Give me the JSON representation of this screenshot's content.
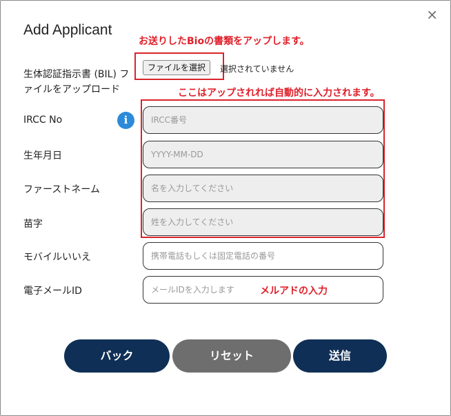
{
  "modal": {
    "title": "Add Applicant",
    "close_symbol": "×"
  },
  "annotations": {
    "bio_upload_note": "お送りしたBioの書類をアップします。",
    "auto_fill_note": "ここはアップされれば自動的に入力されます。",
    "email_note": "メルアドの入力"
  },
  "form": {
    "bil_label_line1": "生体認証指示書 (BIL) フ",
    "bil_label_line2": "ァイルをアップロード",
    "file_button_label": "ファイルを選択",
    "file_status": "選択されていません",
    "ircc_label": "IRCC No",
    "ircc_placeholder": "IRCC番号",
    "dob_label": "生年月日",
    "dob_placeholder": "YYYY-MM-DD",
    "first_name_label": "ファーストネーム",
    "first_name_placeholder": "名を入力してください",
    "last_name_label": "苗字",
    "last_name_placeholder": "姓を入力してください",
    "mobile_label": "モバイルいいえ",
    "mobile_placeholder": "携帯電話もしくは固定電話の番号",
    "email_label": "電子メールID",
    "email_placeholder": "メールIDを入力します"
  },
  "buttons": {
    "back": "バック",
    "reset": "リセット",
    "send": "送信"
  },
  "icons": {
    "info": "i"
  },
  "colors": {
    "primary_button": "#0f2f56",
    "reset_button": "#6e6e6e",
    "annotation_red": "#d8232a",
    "info_icon": "#2d8ad9"
  }
}
